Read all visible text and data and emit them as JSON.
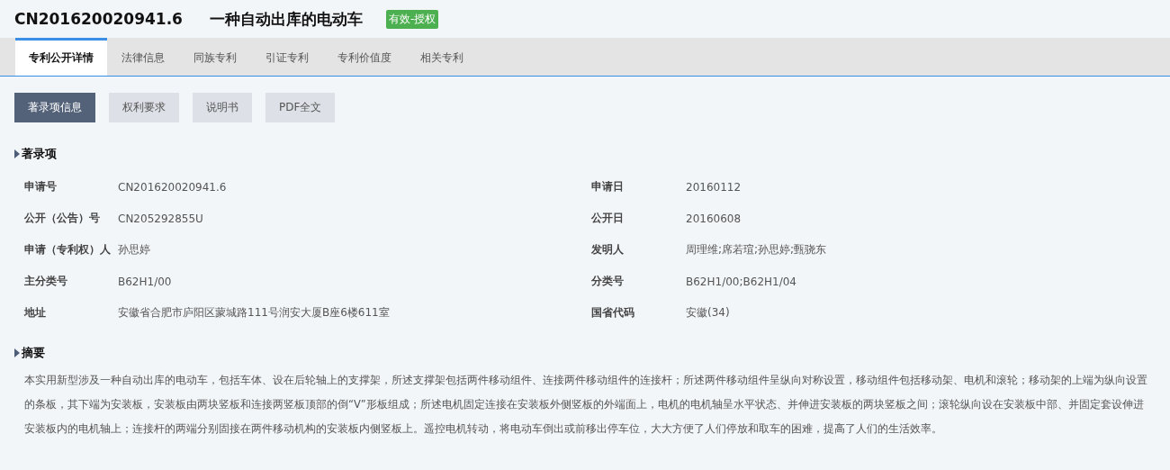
{
  "header": {
    "number": "CN201620020941.6",
    "title": "一种自动出库的电动车",
    "status": "有效-授权"
  },
  "tabs": [
    {
      "label": "专利公开详情",
      "selected": true
    },
    {
      "label": "法律信息",
      "selected": false
    },
    {
      "label": "同族专利",
      "selected": false
    },
    {
      "label": "引证专利",
      "selected": false
    },
    {
      "label": "专利价值度",
      "selected": false
    },
    {
      "label": "相关专利",
      "selected": false
    }
  ],
  "subtabs": [
    {
      "label": "著录项信息",
      "selected": true
    },
    {
      "label": "权利要求",
      "selected": false
    },
    {
      "label": "说明书",
      "selected": false
    },
    {
      "label": "PDF全文",
      "selected": false
    }
  ],
  "bibliography": {
    "heading": "著录项",
    "fields": [
      {
        "label": "申请号",
        "value": "CN201620020941.6"
      },
      {
        "label": "申请日",
        "value": "20160112"
      },
      {
        "label": "公开（公告）号",
        "value": "CN205292855U"
      },
      {
        "label": "公开日",
        "value": "20160608"
      },
      {
        "label": "申请（专利权）人",
        "value": "孙思婷"
      },
      {
        "label": "发明人",
        "value": "周理维;席若瑄;孙思婷;甄骁东"
      },
      {
        "label": "主分类号",
        "value": "B62H1/00"
      },
      {
        "label": "分类号",
        "value": "B62H1/00;B62H1/04"
      },
      {
        "label": "地址",
        "value": "安徽省合肥市庐阳区蒙城路111号润安大厦B座6楼611室"
      },
      {
        "label": "国省代码",
        "value": "安徽(34)"
      }
    ]
  },
  "abstract": {
    "heading": "摘要",
    "text": "本实用新型涉及一种自动出库的电动车，包括车体、设在后轮轴上的支撑架，所述支撑架包括两件移动组件、连接两件移动组件的连接杆；所述两件移动组件呈纵向对称设置，移动组件包括移动架、电机和滚轮；移动架的上端为纵向设置的条板，其下端为安装板，安装板由两块竖板和连接两竖板顶部的倒“V”形板组成；所述电机固定连接在安装板外侧竖板的外端面上，电机的电机轴呈水平状态、并伸进安装板的两块竖板之间；滚轮纵向设在安装板中部、并固定套设伸进安装板内的电机轴上；连接杆的两端分别固接在两件移动机构的安装板内侧竖板上。遥控电机转动，将电动车倒出或前移出停车位，大大方便了人们停放和取车的困难，提高了人们的生活效率。"
  }
}
